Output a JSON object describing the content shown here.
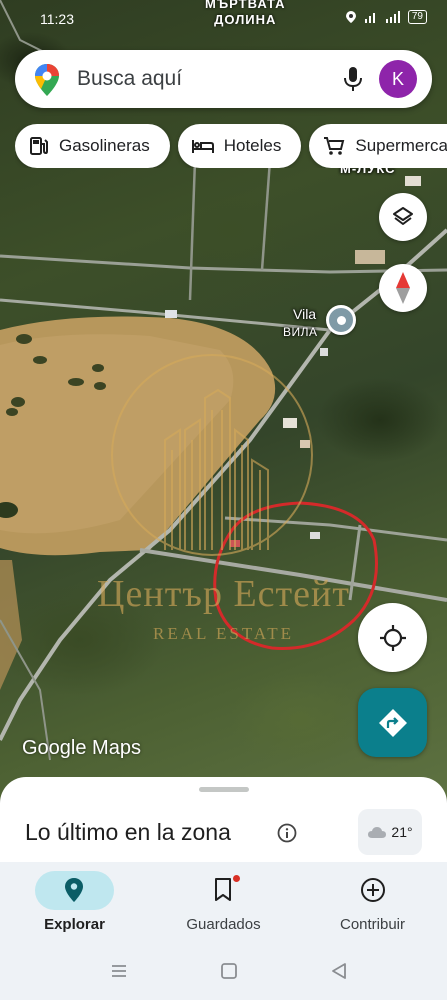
{
  "status_bar": {
    "time": "11:23",
    "battery": "79",
    "top_place_label_line1": "МЪРТВАТА",
    "top_place_label_line2": "ДОЛИНА"
  },
  "search": {
    "placeholder": "Busca aquí",
    "avatar_letter": "K"
  },
  "chips": [
    {
      "label": "Gasolineras",
      "icon": "gas-station-icon"
    },
    {
      "label": "Hoteles",
      "icon": "bed-icon"
    },
    {
      "label": "Supermercados",
      "icon": "cart-icon"
    }
  ],
  "map": {
    "street_label": "М-ЛУКС",
    "place_name": "Vila",
    "place_name_local": "ВИЛА",
    "watermark_title": "Център Естейт",
    "watermark_subtitle": "REAL ESTATE",
    "attribution": "Google Maps"
  },
  "sheet": {
    "title": "Lo último en la zona",
    "temperature": "21°"
  },
  "nav": [
    {
      "label": "Explorar",
      "icon": "explore-pin-icon",
      "active": true
    },
    {
      "label": "Guardados",
      "icon": "bookmark-icon",
      "active": false
    },
    {
      "label": "Contribuir",
      "icon": "add-circle-icon",
      "active": false
    }
  ],
  "colors": {
    "accent": "#0b7f8c",
    "avatar": "#8e24aa",
    "nav_active_pill": "#bfe7ef",
    "highlight_circle": "#d42a2a"
  }
}
